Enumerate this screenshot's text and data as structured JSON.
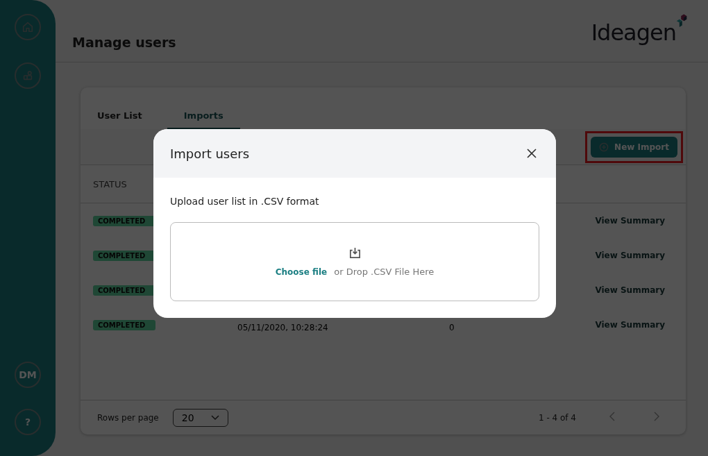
{
  "sidebar": {
    "nav": [
      {
        "kind": "home"
      },
      {
        "kind": "users"
      }
    ],
    "profile": "DM",
    "help": "?"
  },
  "header": {
    "title": "Manage users",
    "logo": "Ideagen"
  },
  "tabs": [
    {
      "label": "User List",
      "selected": false
    },
    {
      "label": "Imports",
      "selected": true
    }
  ],
  "toolbar": {
    "new_button": "New Import",
    "highlighted": true
  },
  "table": {
    "columns": [
      "STATUS"
    ],
    "rows": [
      {
        "status": "COMPLETED",
        "action": "View Summary"
      },
      {
        "status": "COMPLETED",
        "action": "View Summary"
      },
      {
        "status": "COMPLETED",
        "action": "View Summary"
      },
      {
        "status": "COMPLETED",
        "date": "05/11/2020, 10:28:24",
        "count": "0",
        "action": "View Summary"
      }
    ]
  },
  "pagination": {
    "label": "Rows per page",
    "rows_per_page": "20",
    "range": "1 - 4 of 4"
  },
  "modal": {
    "title": "Import users",
    "instruction": "Upload user list in .CSV format",
    "choose": "Choose file",
    "drop": "or Drop .CSV File Here"
  }
}
